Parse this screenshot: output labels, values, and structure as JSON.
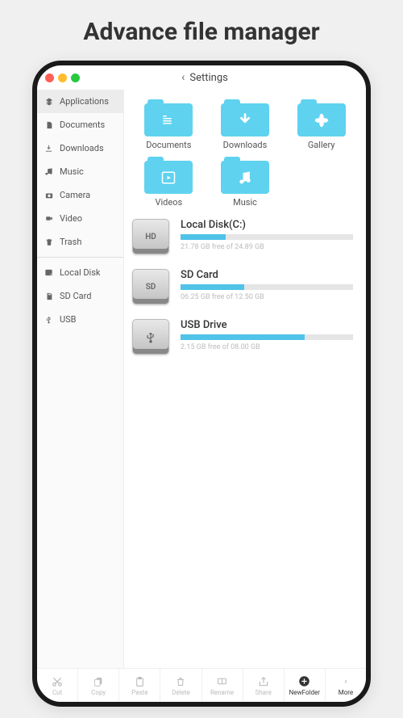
{
  "page_title": "Advance file manager",
  "titlebar": {
    "title": "Settings"
  },
  "sidebar": {
    "groups": [
      {
        "items": [
          {
            "icon": "apps",
            "label": "Applications",
            "active": true
          },
          {
            "icon": "doc",
            "label": "Documents"
          },
          {
            "icon": "download",
            "label": "Downloads"
          },
          {
            "icon": "music",
            "label": "Music"
          },
          {
            "icon": "camera",
            "label": "Camera"
          },
          {
            "icon": "video",
            "label": "Video"
          },
          {
            "icon": "trash",
            "label": "Trash"
          }
        ]
      },
      {
        "items": [
          {
            "icon": "disk",
            "label": "Local Disk"
          },
          {
            "icon": "sd",
            "label": "SD Card"
          },
          {
            "icon": "usb",
            "label": "USB"
          }
        ]
      }
    ]
  },
  "folders": [
    {
      "glyph": "list",
      "label": "Documents"
    },
    {
      "glyph": "down",
      "label": "Downloads"
    },
    {
      "glyph": "flower",
      "label": "Gallery"
    },
    {
      "glyph": "play",
      "label": "Videos"
    },
    {
      "glyph": "note",
      "label": "Music"
    }
  ],
  "drives": [
    {
      "badge": "HD",
      "name": "Local Disk(C:)",
      "fill": 26,
      "sub": "21.78 GB free of 24.89 GB"
    },
    {
      "badge": "SD",
      "name": "SD Card",
      "fill": 37,
      "sub": "06.25 GB free of 12.50 GB"
    },
    {
      "badge": "usb",
      "name": "USB Drive",
      "fill": 72,
      "sub": "2.15 GB free of 08.00 GB"
    }
  ],
  "toolbar": [
    {
      "icon": "cut",
      "label": "Cut"
    },
    {
      "icon": "copy",
      "label": "Copy"
    },
    {
      "icon": "paste",
      "label": "Paste"
    },
    {
      "icon": "delete",
      "label": "Delete"
    },
    {
      "icon": "rename",
      "label": "Rename"
    },
    {
      "icon": "share",
      "label": "Share"
    },
    {
      "icon": "newfolder",
      "label": "NewFolder",
      "dark": true
    },
    {
      "icon": "more",
      "label": "More",
      "dark": true
    }
  ]
}
